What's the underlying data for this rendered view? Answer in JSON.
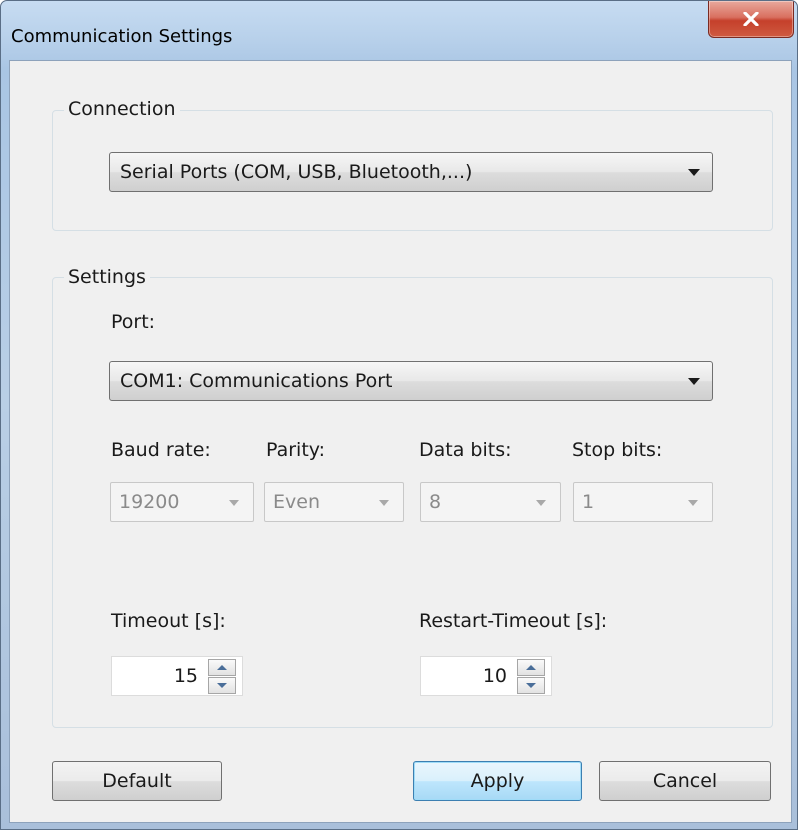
{
  "window": {
    "title": "Communication Settings"
  },
  "connection": {
    "legend": "Connection",
    "type_value": "Serial Ports (COM, USB, Bluetooth,...)"
  },
  "settings": {
    "legend": "Settings",
    "port_label": "Port:",
    "port_value": "COM1: Communications Port",
    "baud_label": "Baud rate:",
    "baud_value": "19200",
    "parity_label": "Parity:",
    "parity_value": "Even",
    "databits_label": "Data bits:",
    "databits_value": "8",
    "stopbits_label": "Stop bits:",
    "stopbits_value": "1",
    "timeout_label": "Timeout [s]:",
    "timeout_value": "15",
    "restart_timeout_label": "Restart-Timeout [s]:",
    "restart_timeout_value": "10"
  },
  "buttons": {
    "default": "Default",
    "apply": "Apply",
    "cancel": "Cancel"
  },
  "icons": {
    "close": "close-icon",
    "dropdown": "chevron-down-icon",
    "spin_up": "arrow-up-icon",
    "spin_down": "arrow-down-icon"
  },
  "colors": {
    "close_button": "#c5402b",
    "primary_button_border": "#3c7fb1",
    "dialog_background": "#f0f0f0"
  }
}
